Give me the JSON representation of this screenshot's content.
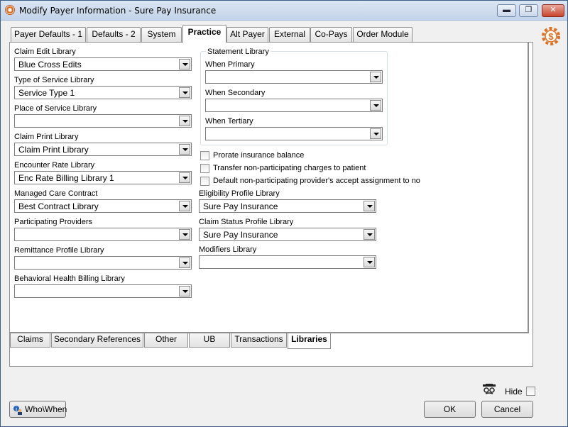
{
  "window": {
    "title": "Modify Payer Information - Sure Pay Insurance",
    "controls": {
      "minimize": "▬",
      "maximize": "❐",
      "close": "✕"
    }
  },
  "top_tabs": [
    {
      "label": "Payer Defaults - 1"
    },
    {
      "label": "Defaults - 2"
    },
    {
      "label": "System"
    },
    {
      "label": "Practice",
      "active": true
    },
    {
      "label": "Alt Payer"
    },
    {
      "label": "External"
    },
    {
      "label": "Co-Pays"
    },
    {
      "label": "Order Module"
    }
  ],
  "left_fields": [
    {
      "label": "Claim Edit Library",
      "value": "Blue Cross Edits"
    },
    {
      "label": "Type of Service Library",
      "value": "Service Type 1"
    },
    {
      "label": "Place of Service Library",
      "value": ""
    },
    {
      "label": "Claim Print Library",
      "value": "Claim Print Library"
    },
    {
      "label": "Encounter Rate Library",
      "value": "Enc Rate Billing Library 1"
    },
    {
      "label": "Managed Care Contract",
      "value": "Best Contract Library"
    },
    {
      "label": "Participating Providers",
      "value": ""
    },
    {
      "label": "Remittance Profile Library",
      "value": ""
    },
    {
      "label": "Behavioral Health Billing Library",
      "value": ""
    }
  ],
  "statement_library": {
    "caption": "Statement Library",
    "fields": [
      {
        "label": "When Primary",
        "value": ""
      },
      {
        "label": "When Secondary",
        "value": ""
      },
      {
        "label": "When Tertiary",
        "value": ""
      }
    ]
  },
  "checkboxes": [
    {
      "label": "Prorate insurance balance",
      "checked": false
    },
    {
      "label": "Transfer non-participating charges to patient",
      "checked": false
    },
    {
      "label": "Default non-participating provider's accept assignment to no",
      "checked": false
    }
  ],
  "right_fields": [
    {
      "label": "Eligibility Profile Library",
      "value": "Sure Pay Insurance"
    },
    {
      "label": "Claim Status Profile Library",
      "value": "Sure Pay Insurance"
    },
    {
      "label": "Modifiers Library",
      "value": ""
    }
  ],
  "bottom_tabs": [
    {
      "label": "Claims"
    },
    {
      "label": "Secondary References"
    },
    {
      "label": "Other"
    },
    {
      "label": "UB"
    },
    {
      "label": "Transactions"
    },
    {
      "label": "Libraries",
      "active": true
    }
  ],
  "footer": {
    "who_when": "Who\\When",
    "hide_label": "Hide",
    "hide_checked": false,
    "ok": "OK",
    "cancel": "Cancel"
  },
  "colors": {
    "accent": "#e07020",
    "window_frame": "#3c5e86"
  },
  "icons": {
    "app": "gear-dollar-icon",
    "side": "gear-dollar-icon",
    "hide": "spy-icon",
    "who_when": "info-person-icon"
  }
}
